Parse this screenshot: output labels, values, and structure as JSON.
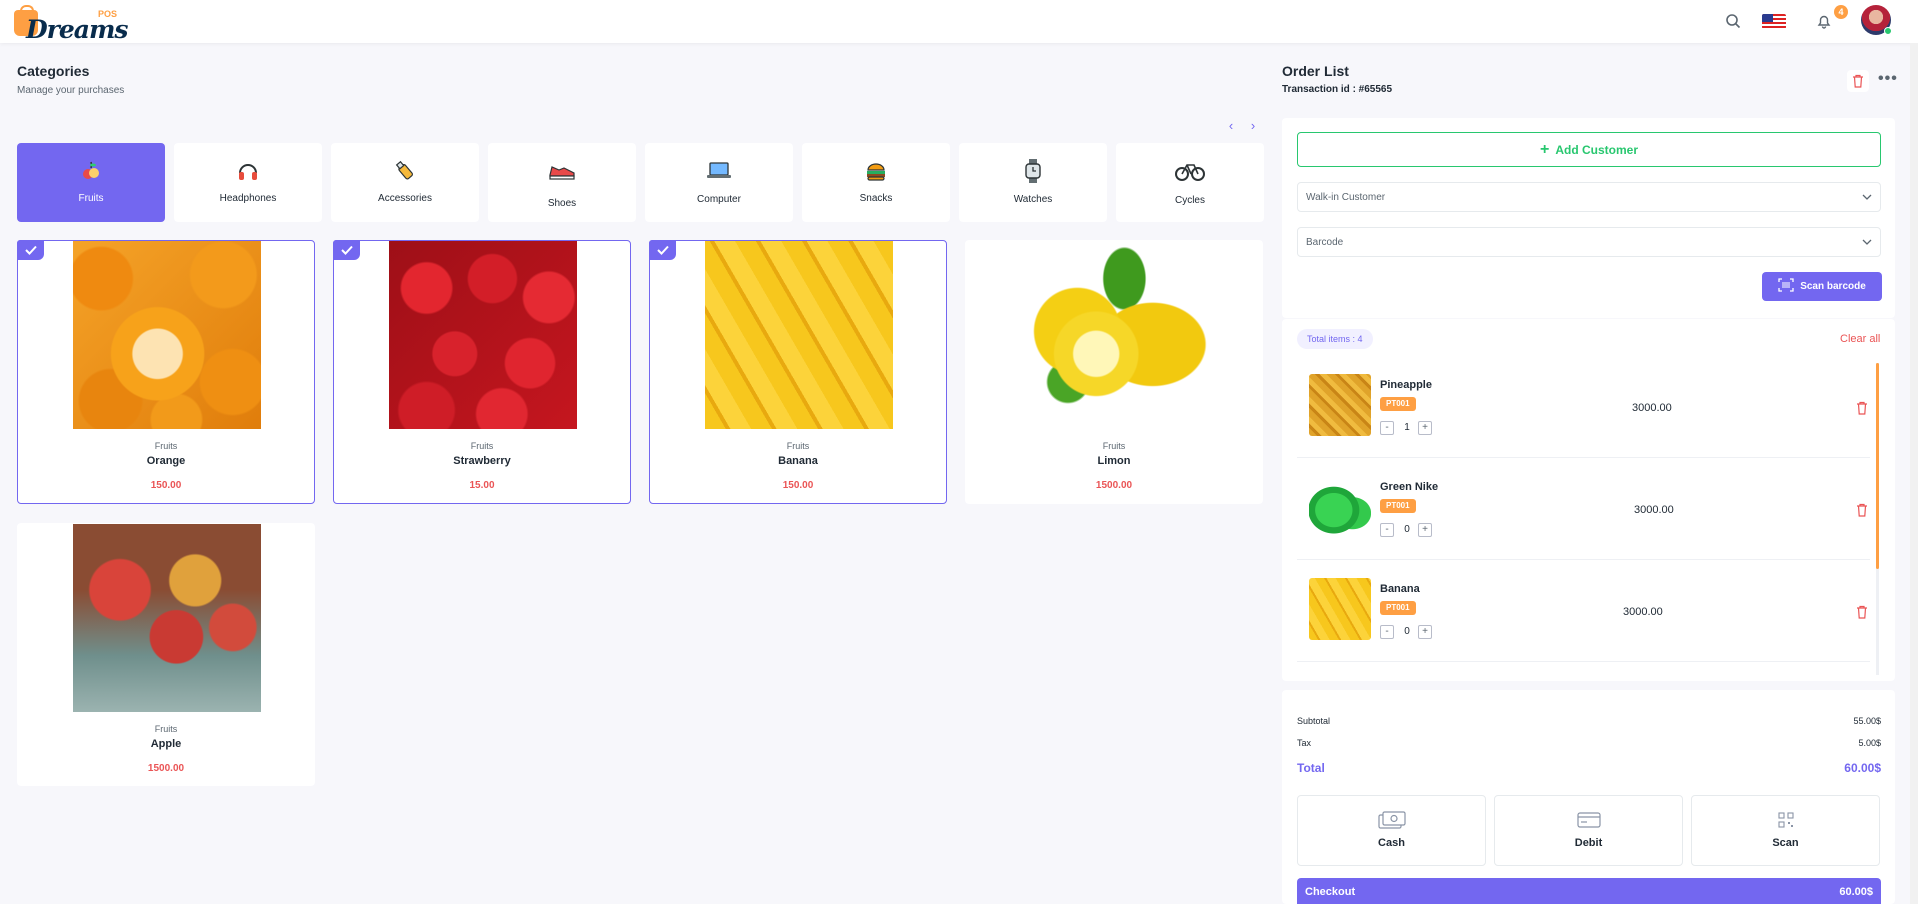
{
  "header": {
    "logo_text": "Dreams",
    "logo_sub": "POS",
    "notification_count": "4",
    "icons": [
      "search-icon",
      "us-flag-icon",
      "bell-icon",
      "avatar"
    ]
  },
  "colors": {
    "primary": "#7367f0",
    "orange": "#fe9f43",
    "red": "#ea5455",
    "green": "#28c76f"
  },
  "categories": {
    "title": "Categories",
    "subtitle": "Manage your purchases",
    "items": [
      {
        "label": "Fruits",
        "icon": "fruits-icon",
        "active": true
      },
      {
        "label": "Headphones",
        "icon": "headphones-icon"
      },
      {
        "label": "Accessories",
        "icon": "usb-drive-icon"
      },
      {
        "label": "Shoes",
        "icon": "sneaker-icon"
      },
      {
        "label": "Computer",
        "icon": "laptop-icon"
      },
      {
        "label": "Snacks",
        "icon": "burger-icon"
      },
      {
        "label": "Watches",
        "icon": "watch-icon"
      },
      {
        "label": "Cycles",
        "icon": "bicycle-icon"
      }
    ]
  },
  "products": [
    {
      "category": "Fruits",
      "name": "Orange",
      "price": "150.00",
      "selected": true
    },
    {
      "category": "Fruits",
      "name": "Strawberry",
      "price": "15.00",
      "selected": true
    },
    {
      "category": "Fruits",
      "name": "Banana",
      "price": "150.00",
      "selected": true
    },
    {
      "category": "Fruits",
      "name": "Limon",
      "price": "1500.00",
      "selected": false
    },
    {
      "category": "Fruits",
      "name": "Apple",
      "price": "1500.00",
      "selected": false
    }
  ],
  "order": {
    "title": "Order List",
    "transaction": "Transaction id : #65565",
    "add_customer": "Add Customer",
    "customer_select": "Walk-in Customer",
    "barcode_select": "Barcode",
    "scan_barcode": "Scan barcode",
    "total_items": "Total items : 4",
    "clear_all": "Clear all",
    "items": [
      {
        "name": "Pineapple",
        "code": "PT001",
        "qty": "1",
        "price": "3000.00"
      },
      {
        "name": "Green Nike",
        "code": "PT001",
        "qty": "0",
        "price": "3000.00"
      },
      {
        "name": "Banana",
        "code": "PT001",
        "qty": "0",
        "price": "3000.00"
      }
    ],
    "summary": {
      "subtotal_label": "Subtotal",
      "subtotal": "55.00$",
      "tax_label": "Tax",
      "tax": "5.00$",
      "total_label": "Total",
      "total": "60.00$"
    },
    "payments": [
      {
        "label": "Cash",
        "icon": "cash-icon"
      },
      {
        "label": "Debit",
        "icon": "card-icon"
      },
      {
        "label": "Scan",
        "icon": "qr-icon"
      }
    ],
    "checkout_label": "Checkout",
    "checkout_amount": "60.00$"
  }
}
